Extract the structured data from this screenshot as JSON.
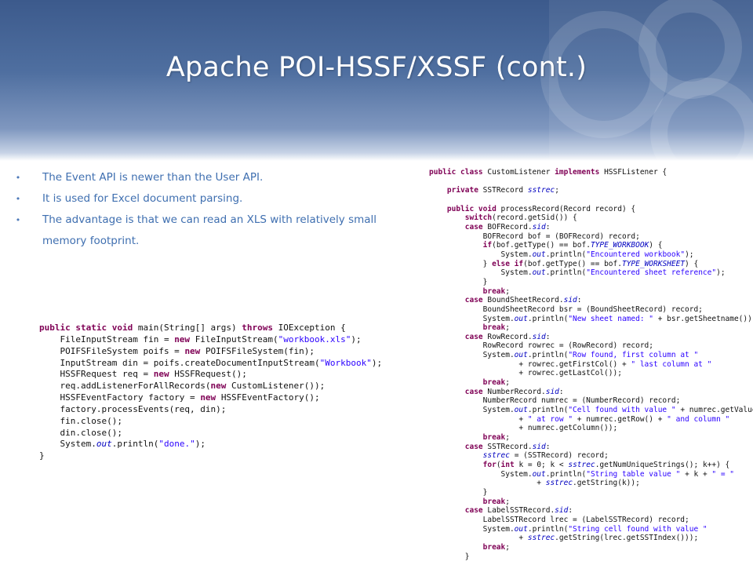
{
  "slide": {
    "title": "Apache POI-HSSF/XSSF (cont.)",
    "bullets": [
      "The Event API is newer than the User API.",
      "It is used for Excel document parsing.",
      "The advantage is that we can read an XLS with relatively small memory footprint."
    ]
  },
  "code_main": [
    [
      [
        "kw",
        "public static void"
      ],
      [
        "",
        "main(String[] args) "
      ],
      [
        "kw",
        "throws"
      ],
      [
        "",
        "IOException {"
      ]
    ],
    [
      [
        "",
        "    FileInputStream fin = "
      ],
      [
        "kw",
        "new"
      ],
      [
        "",
        "FileInputStream("
      ],
      [
        "str",
        "\"workbook.xls\""
      ],
      [
        "",
        ");"
      ]
    ],
    [
      [
        "",
        "    POIFSFileSystem poifs = "
      ],
      [
        "kw",
        "new"
      ],
      [
        "",
        "POIFSFileSystem(fin);"
      ]
    ],
    [
      [
        "",
        "    InputStream din = poifs.createDocumentInputStream("
      ],
      [
        "str",
        "\"Workbook\""
      ],
      [
        "",
        ");"
      ]
    ],
    [
      [
        "",
        "    HSSFRequest req = "
      ],
      [
        "kw",
        "new"
      ],
      [
        "",
        "HSSFRequest();"
      ]
    ],
    [
      [
        "",
        "    req.addListenerForAllRecords("
      ],
      [
        "kw",
        "new"
      ],
      [
        "",
        "CustomListener());"
      ]
    ],
    [
      [
        "",
        "    HSSFEventFactory factory = "
      ],
      [
        "kw",
        "new"
      ],
      [
        "",
        "HSSFEventFactory();"
      ]
    ],
    [
      [
        "",
        "    factory.processEvents(req, din);"
      ]
    ],
    [
      [
        "",
        "    fin.close();"
      ]
    ],
    [
      [
        "",
        "    din.close();"
      ]
    ],
    [
      [
        "",
        "    System."
      ],
      [
        "fld",
        "out"
      ],
      [
        "",
        ".println("
      ],
      [
        "str",
        "\"done.\""
      ],
      [
        "",
        ");"
      ]
    ],
    [
      [
        "",
        "}"
      ]
    ]
  ],
  "code_listener": [
    [
      [
        "kw",
        "public class"
      ],
      [
        "",
        "CustomListener "
      ],
      [
        "kw",
        "implements"
      ],
      [
        "",
        "HSSFListener {"
      ]
    ],
    [
      [
        "",
        ""
      ]
    ],
    [
      [
        "",
        "    "
      ],
      [
        "kw",
        "private"
      ],
      [
        "",
        "SSTRecord "
      ],
      [
        "fld",
        "sstrec"
      ],
      [
        "",
        ";"
      ]
    ],
    [
      [
        "",
        ""
      ]
    ],
    [
      [
        "",
        "    "
      ],
      [
        "kw",
        "public void"
      ],
      [
        "",
        "processRecord(Record record) {"
      ]
    ],
    [
      [
        "",
        "        "
      ],
      [
        "kw",
        "switch"
      ],
      [
        "",
        "(record.getSid()) {"
      ]
    ],
    [
      [
        "",
        "        "
      ],
      [
        "kw",
        "case"
      ],
      [
        "",
        "BOFRecord."
      ],
      [
        "fld",
        "sid"
      ],
      [
        "",
        ":"
      ]
    ],
    [
      [
        "",
        "            BOFRecord bof = (BOFRecord) record;"
      ]
    ],
    [
      [
        "",
        "            "
      ],
      [
        "kw",
        "if"
      ],
      [
        "",
        "(bof.getType() == bof."
      ],
      [
        "fld",
        "TYPE_WORKBOOK"
      ],
      [
        "",
        ") {"
      ]
    ],
    [
      [
        "",
        "                System."
      ],
      [
        "fld",
        "out"
      ],
      [
        "",
        ".println("
      ],
      [
        "str",
        "\"Encountered workbook\""
      ],
      [
        "",
        ");"
      ]
    ],
    [
      [
        "",
        "            } "
      ],
      [
        "kw",
        "else if"
      ],
      [
        "",
        "(bof.getType() == bof."
      ],
      [
        "fld",
        "TYPE_WORKSHEET"
      ],
      [
        "",
        ") {"
      ]
    ],
    [
      [
        "",
        "                System."
      ],
      [
        "fld",
        "out"
      ],
      [
        "",
        ".println("
      ],
      [
        "str",
        "\"Encountered sheet reference\""
      ],
      [
        "",
        ");"
      ]
    ],
    [
      [
        "",
        "            }"
      ]
    ],
    [
      [
        "",
        "            "
      ],
      [
        "kw",
        "break"
      ],
      [
        "",
        ";"
      ]
    ],
    [
      [
        "",
        "        "
      ],
      [
        "kw",
        "case"
      ],
      [
        "",
        "BoundSheetRecord."
      ],
      [
        "fld",
        "sid"
      ],
      [
        "",
        ":"
      ]
    ],
    [
      [
        "",
        "            BoundSheetRecord bsr = (BoundSheetRecord) record;"
      ]
    ],
    [
      [
        "",
        "            System."
      ],
      [
        "fld",
        "out"
      ],
      [
        "",
        ".println("
      ],
      [
        "str",
        "\"New sheet named: \""
      ],
      [
        "",
        "+ bsr.getSheetname());"
      ]
    ],
    [
      [
        "",
        "            "
      ],
      [
        "kw",
        "break"
      ],
      [
        "",
        ";"
      ]
    ],
    [
      [
        "",
        "        "
      ],
      [
        "kw",
        "case"
      ],
      [
        "",
        "RowRecord."
      ],
      [
        "fld",
        "sid"
      ],
      [
        "",
        ":"
      ]
    ],
    [
      [
        "",
        "            RowRecord rowrec = (RowRecord) record;"
      ]
    ],
    [
      [
        "",
        "            System."
      ],
      [
        "fld",
        "out"
      ],
      [
        "",
        ".println("
      ],
      [
        "str",
        "\"Row found, first column at \""
      ]
    ],
    [
      [
        "",
        "                    + rowrec.getFirstCol() + "
      ],
      [
        "str",
        "\" last column at \""
      ]
    ],
    [
      [
        "",
        "                    + rowrec.getLastCol());"
      ]
    ],
    [
      [
        "",
        "            "
      ],
      [
        "kw",
        "break"
      ],
      [
        "",
        ";"
      ]
    ],
    [
      [
        "",
        "        "
      ],
      [
        "kw",
        "case"
      ],
      [
        "",
        "NumberRecord."
      ],
      [
        "fld",
        "sid"
      ],
      [
        "",
        ":"
      ]
    ],
    [
      [
        "",
        "            NumberRecord numrec = (NumberRecord) record;"
      ]
    ],
    [
      [
        "",
        "            System."
      ],
      [
        "fld",
        "out"
      ],
      [
        "",
        ".println("
      ],
      [
        "str",
        "\"Cell found with value \""
      ],
      [
        "",
        "+ numrec.getValue()"
      ]
    ],
    [
      [
        "",
        "                    + "
      ],
      [
        "str",
        "\" at row \""
      ],
      [
        "",
        "+ numrec.getRow() + "
      ],
      [
        "str",
        "\" and column \""
      ]
    ],
    [
      [
        "",
        "                    + numrec.getColumn());"
      ]
    ],
    [
      [
        "",
        "            "
      ],
      [
        "kw",
        "break"
      ],
      [
        "",
        ";"
      ]
    ],
    [
      [
        "",
        "        "
      ],
      [
        "kw",
        "case"
      ],
      [
        "",
        "SSTRecord."
      ],
      [
        "fld",
        "sid"
      ],
      [
        "",
        ":"
      ]
    ],
    [
      [
        "",
        "            "
      ],
      [
        "fld",
        "sstrec"
      ],
      [
        "",
        "= (SSTRecord) record;"
      ]
    ],
    [
      [
        "",
        "            "
      ],
      [
        "kw",
        "for"
      ],
      [
        "",
        "("
      ],
      [
        "kw",
        "int"
      ],
      [
        "",
        "k = 0; k < "
      ],
      [
        "fld",
        "sstrec"
      ],
      [
        "",
        ".getNumUniqueStrings(); k++) {"
      ]
    ],
    [
      [
        "",
        "                System."
      ],
      [
        "fld",
        "out"
      ],
      [
        "",
        ".println("
      ],
      [
        "str",
        "\"String table value \""
      ],
      [
        "",
        "+ k + "
      ],
      [
        "str",
        "\" = \""
      ]
    ],
    [
      [
        "",
        "                        + "
      ],
      [
        "fld",
        "sstrec"
      ],
      [
        "",
        ".getString(k));"
      ]
    ],
    [
      [
        "",
        "            }"
      ]
    ],
    [
      [
        "",
        "            "
      ],
      [
        "kw",
        "break"
      ],
      [
        "",
        ";"
      ]
    ],
    [
      [
        "",
        "        "
      ],
      [
        "kw",
        "case"
      ],
      [
        "",
        "LabelSSTRecord."
      ],
      [
        "fld",
        "sid"
      ],
      [
        "",
        ":"
      ]
    ],
    [
      [
        "",
        "            LabelSSTRecord lrec = (LabelSSTRecord) record;"
      ]
    ],
    [
      [
        "",
        "            System."
      ],
      [
        "fld",
        "out"
      ],
      [
        "",
        ".println("
      ],
      [
        "str",
        "\"String cell found with value \""
      ]
    ],
    [
      [
        "",
        "                    + "
      ],
      [
        "fld",
        "sstrec"
      ],
      [
        "",
        ".getString(lrec.getSSTIndex()));"
      ]
    ],
    [
      [
        "",
        "            "
      ],
      [
        "kw",
        "break"
      ],
      [
        "",
        ";"
      ]
    ],
    [
      [
        "",
        "        }"
      ]
    ]
  ]
}
